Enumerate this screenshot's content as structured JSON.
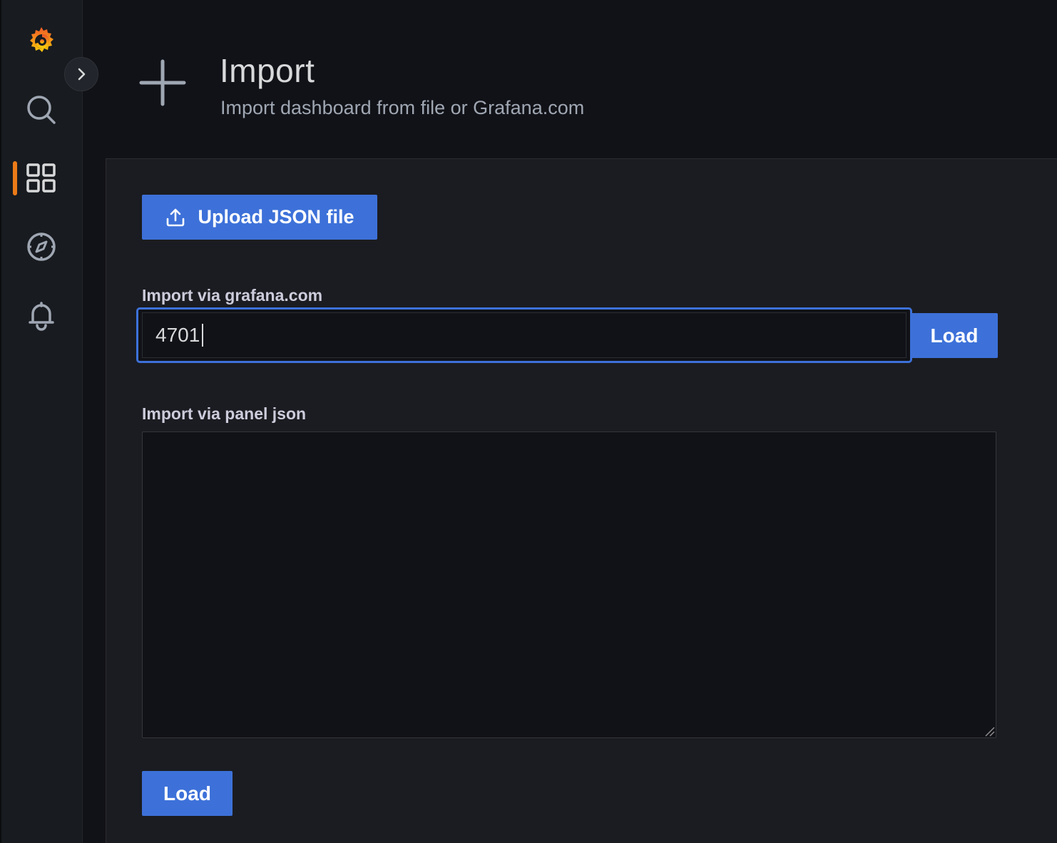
{
  "sidebar": {
    "items": [
      {
        "name": "grafana-logo",
        "icon": "grafana-logo-icon"
      },
      {
        "name": "search",
        "icon": "search-icon"
      },
      {
        "name": "dashboards",
        "icon": "dashboards-icon",
        "active": true
      },
      {
        "name": "explore",
        "icon": "compass-icon"
      },
      {
        "name": "alerting",
        "icon": "bell-icon"
      }
    ],
    "expand_icon": "chevron-right-icon"
  },
  "header": {
    "icon": "plus-icon",
    "title": "Import",
    "subtitle": "Import dashboard from file or Grafana.com"
  },
  "main": {
    "upload_button_label": "Upload JSON file",
    "upload_icon": "upload-icon",
    "grafana_com_label": "Import via grafana.com",
    "grafana_com_value": "4701",
    "grafana_com_load_label": "Load",
    "panel_json_label": "Import via panel json",
    "panel_json_value": "",
    "panel_json_load_label": "Load"
  },
  "colors": {
    "accent": "#3d71d9",
    "background": "#111217",
    "panel": "#1b1c21",
    "sidebar": "#181b1f",
    "active_indicator": "#eb7b18"
  }
}
